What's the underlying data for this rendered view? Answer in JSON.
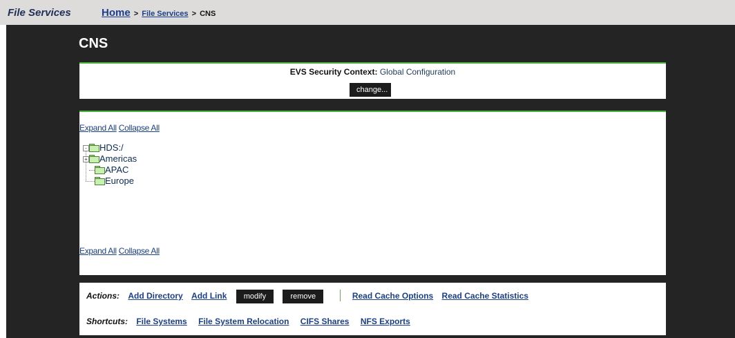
{
  "app": {
    "title": "File Services"
  },
  "breadcrumb": {
    "home": "Home",
    "sep": ">",
    "section": "File Services",
    "current": "CNS"
  },
  "page": {
    "title": "CNS"
  },
  "security_context": {
    "label": "EVS Security Context:",
    "value": "Global Configuration",
    "change_button": "change..."
  },
  "tree_controls": {
    "expand_all": "Expand All",
    "collapse_all": "Collapse All"
  },
  "tree": {
    "root": {
      "label": "HDS:/",
      "expander": "-"
    },
    "children": [
      {
        "label": "Americas",
        "expander": "+"
      },
      {
        "label": "APAC"
      },
      {
        "label": "Europe"
      }
    ]
  },
  "actions": {
    "label": "Actions:",
    "add_directory": "Add Directory",
    "add_link": "Add Link",
    "modify": "modify",
    "remove": "remove",
    "read_cache_options": "Read Cache Options",
    "read_cache_statistics": "Read Cache Statistics"
  },
  "shortcuts": {
    "label": "Shortcuts:",
    "items": [
      "File Systems",
      "File System Relocation",
      "CIFS Shares",
      "NFS Exports"
    ]
  },
  "colors": {
    "accent_green": "#48b33a",
    "link_blue": "#1a3f8a",
    "dark_background": "#242424",
    "header_bar": "#dedcdb"
  },
  "icons": {
    "folder": "folder-icon",
    "expand": "plus-box-icon",
    "collapse": "minus-box-icon"
  }
}
